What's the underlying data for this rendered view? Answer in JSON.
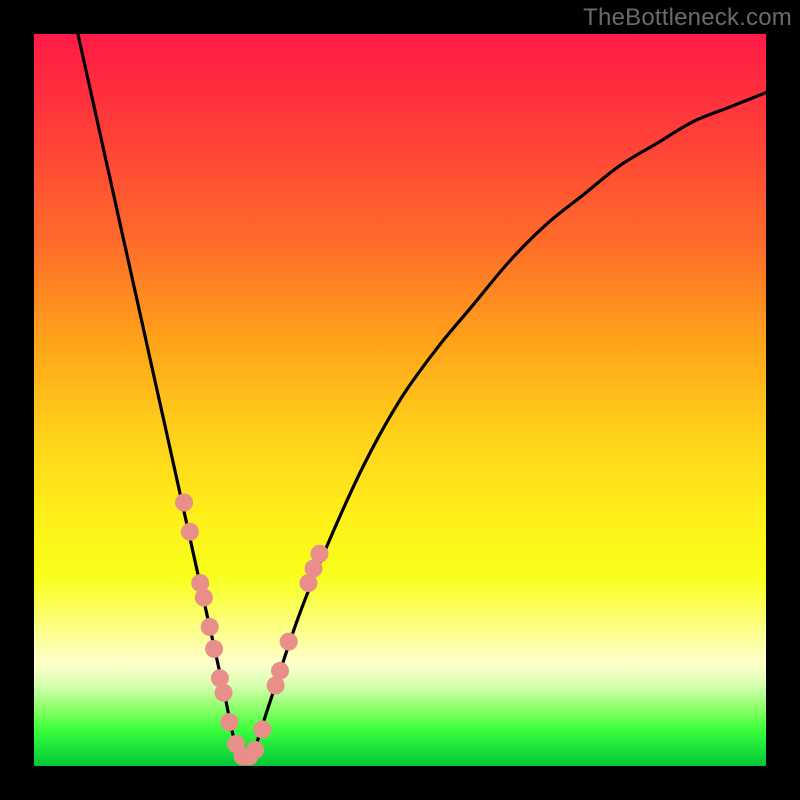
{
  "watermark": "TheBottleneck.com",
  "chart_data": {
    "type": "line",
    "title": "",
    "xlabel": "",
    "ylabel": "",
    "xlim": [
      0,
      100
    ],
    "ylim": [
      0,
      100
    ],
    "series": [
      {
        "name": "bottleneck-curve",
        "x": [
          6,
          8,
          10,
          12,
          14,
          16,
          18,
          20,
          22,
          24,
          26,
          27,
          28,
          29,
          30,
          32,
          36,
          40,
          45,
          50,
          55,
          60,
          65,
          70,
          75,
          80,
          85,
          90,
          95,
          100
        ],
        "y": [
          100,
          91,
          82,
          73,
          64,
          55,
          46,
          37,
          28,
          19,
          10,
          5,
          2,
          1,
          2,
          8,
          20,
          30,
          41,
          50,
          57,
          63,
          69,
          74,
          78,
          82,
          85,
          88,
          90,
          92
        ]
      }
    ],
    "markers": {
      "name": "highlighted-points",
      "color": "#e98f89",
      "points": [
        {
          "x": 20.5,
          "y": 36
        },
        {
          "x": 21.3,
          "y": 32
        },
        {
          "x": 22.7,
          "y": 25
        },
        {
          "x": 23.2,
          "y": 23
        },
        {
          "x": 24.0,
          "y": 19
        },
        {
          "x": 24.6,
          "y": 16
        },
        {
          "x": 25.4,
          "y": 12
        },
        {
          "x": 25.9,
          "y": 10
        },
        {
          "x": 26.7,
          "y": 6
        },
        {
          "x": 27.6,
          "y": 3
        },
        {
          "x": 28.5,
          "y": 1.3
        },
        {
          "x": 29.4,
          "y": 1.3
        },
        {
          "x": 30.2,
          "y": 2.2
        },
        {
          "x": 31.2,
          "y": 5
        },
        {
          "x": 33.0,
          "y": 11
        },
        {
          "x": 33.6,
          "y": 13
        },
        {
          "x": 34.8,
          "y": 17
        },
        {
          "x": 37.5,
          "y": 25
        },
        {
          "x": 38.2,
          "y": 27
        },
        {
          "x": 39.0,
          "y": 29
        }
      ]
    },
    "colors": {
      "curve_stroke": "#000000",
      "marker_fill": "#e98f89",
      "gradient_top": "#ff1a46",
      "gradient_bottom": "#00c838"
    }
  }
}
